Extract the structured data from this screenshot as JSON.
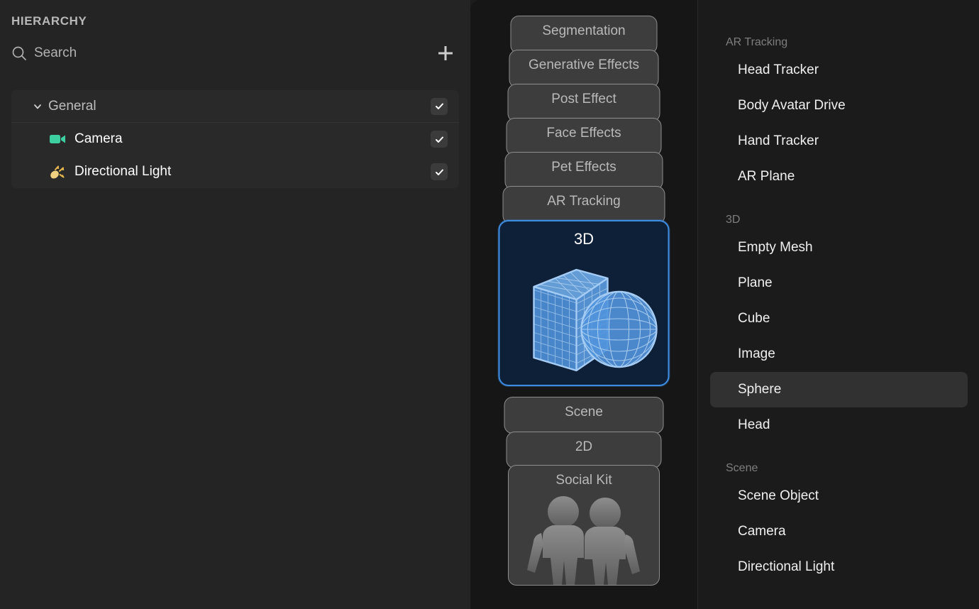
{
  "hierarchy": {
    "title": "HIERARCHY",
    "search": {
      "placeholder": "Search",
      "value": "",
      "icon": "search-icon"
    },
    "add_button": {
      "icon": "plus-icon",
      "label": "+"
    },
    "tree": [
      {
        "label": "General",
        "type": "group",
        "expanded": true,
        "checked": true,
        "icon": "chevron-down-icon"
      },
      {
        "label": "Camera",
        "type": "child",
        "checked": true,
        "icon": "camera-icon",
        "icon_color": "#3ecfa0"
      },
      {
        "label": "Directional Light",
        "type": "child",
        "checked": true,
        "icon": "directional-light-icon",
        "icon_color": "#f0d080"
      }
    ]
  },
  "stack": {
    "cards": [
      {
        "label": "Segmentation",
        "selected": false
      },
      {
        "label": "Generative Effects",
        "selected": false
      },
      {
        "label": "Post Effect",
        "selected": false
      },
      {
        "label": "Face Effects",
        "selected": false
      },
      {
        "label": "Pet Effects",
        "selected": false
      },
      {
        "label": "AR Tracking",
        "selected": false
      },
      {
        "label": "3D",
        "selected": true,
        "art": "cube-and-sphere-wireframe"
      },
      {
        "label": "Scene",
        "selected": false
      },
      {
        "label": "2D",
        "selected": false
      },
      {
        "label": "Social Kit",
        "selected": false,
        "art": "two-people-silhouette"
      }
    ]
  },
  "list": {
    "sections": [
      {
        "header": "AR Tracking",
        "items": [
          {
            "label": "Head Tracker",
            "hovered": false
          },
          {
            "label": "Body Avatar Drive",
            "hovered": false
          },
          {
            "label": "Hand Tracker",
            "hovered": false
          },
          {
            "label": "AR Plane",
            "hovered": false
          }
        ]
      },
      {
        "header": "3D",
        "items": [
          {
            "label": "Empty Mesh",
            "hovered": false
          },
          {
            "label": "Plane",
            "hovered": false
          },
          {
            "label": "Cube",
            "hovered": false
          },
          {
            "label": "Image",
            "hovered": false
          },
          {
            "label": "Sphere",
            "hovered": true
          },
          {
            "label": "Head",
            "hovered": false
          }
        ]
      },
      {
        "header": "Scene",
        "items": [
          {
            "label": "Scene Object",
            "hovered": false
          },
          {
            "label": "Camera",
            "hovered": false
          },
          {
            "label": "Directional Light",
            "hovered": false
          }
        ]
      }
    ]
  },
  "colors": {
    "accent_blue": "#3d8ce0",
    "card_bg": "#3d3d3d",
    "selected_card_bg": "#0e1f38",
    "panel_bg": "#1b1b1b",
    "hierarchy_bg": "#242424",
    "camera_green": "#3ecfa0",
    "light_yellow": "#f0d080"
  }
}
